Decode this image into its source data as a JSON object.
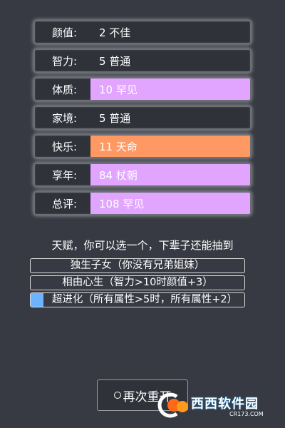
{
  "stats": [
    {
      "label": "颜值:",
      "value": "2 不佳",
      "tier": "normal"
    },
    {
      "label": "智力:",
      "value": "5 普通",
      "tier": "normal"
    },
    {
      "label": "体质:",
      "value": "10 罕见",
      "tier": "rare"
    },
    {
      "label": "家境:",
      "value": "5 普通",
      "tier": "normal"
    },
    {
      "label": "快乐:",
      "value": "11 天命",
      "tier": "destiny"
    },
    {
      "label": "享年:",
      "value": "84 杖朝",
      "tier": "rare"
    },
    {
      "label": "总评:",
      "value": "108 罕见",
      "tier": "rare"
    }
  ],
  "talent": {
    "title": "天赋，你可以选一个，下辈子还能抽到",
    "items": [
      {
        "text": "独生子女（你没有兄弟姐妹）",
        "selected": false
      },
      {
        "text": "相由心生（智力>10时颜值+3）",
        "selected": false
      },
      {
        "text": "超进化（所有属性>5时，所有属性+2）",
        "selected": true
      }
    ]
  },
  "restart": {
    "label": "再次重开"
  },
  "watermark": {
    "brand": "西西软件园",
    "url": "CR173.COM"
  },
  "colors": {
    "background": "#373a42",
    "rare": "#e1a5ff",
    "destiny": "#ff9963",
    "selected_bar": "#6cb4ff"
  }
}
